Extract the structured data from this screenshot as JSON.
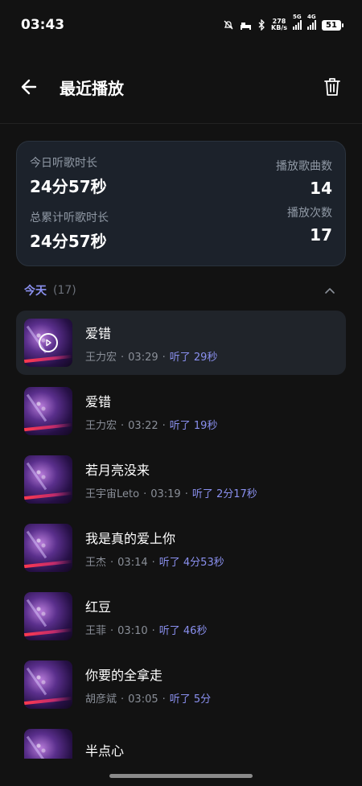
{
  "status_bar": {
    "time": "03:43",
    "net_speed_value": "278",
    "net_speed_unit": "KB/s",
    "signal1_tag": "5G",
    "signal2_tag": "4G",
    "battery": "51"
  },
  "header": {
    "title": "最近播放"
  },
  "stats": {
    "today_label": "今日听歌时长",
    "today_value": "24分57秒",
    "total_label": "总累计听歌时长",
    "total_value": "24分57秒",
    "songs_label": "播放歌曲数",
    "songs_value": "14",
    "plays_label": "播放次数",
    "plays_value": "17"
  },
  "section": {
    "title": "今天",
    "count": "(17)"
  },
  "songs": [
    {
      "name": "爱错",
      "artist": "王力宏",
      "time": "03:29",
      "listened": "听了 29秒"
    },
    {
      "name": "爱错",
      "artist": "王力宏",
      "time": "03:22",
      "listened": "听了 19秒"
    },
    {
      "name": "若月亮没来",
      "artist": "王宇宙Leto",
      "time": "03:19",
      "listened": "听了 2分17秒"
    },
    {
      "name": "我是真的爱上你",
      "artist": "王杰",
      "time": "03:14",
      "listened": "听了 4分53秒"
    },
    {
      "name": "红豆",
      "artist": "王菲",
      "time": "03:10",
      "listened": "听了 46秒"
    },
    {
      "name": "你要的全拿走",
      "artist": "胡彦斌",
      "time": "03:05",
      "listened": "听了 5分"
    },
    {
      "name": "半点心",
      "artist": "",
      "time": "",
      "listened": ""
    }
  ],
  "colors": {
    "accent": "#8a90ef",
    "background": "#121212",
    "card": "#1c222b"
  }
}
